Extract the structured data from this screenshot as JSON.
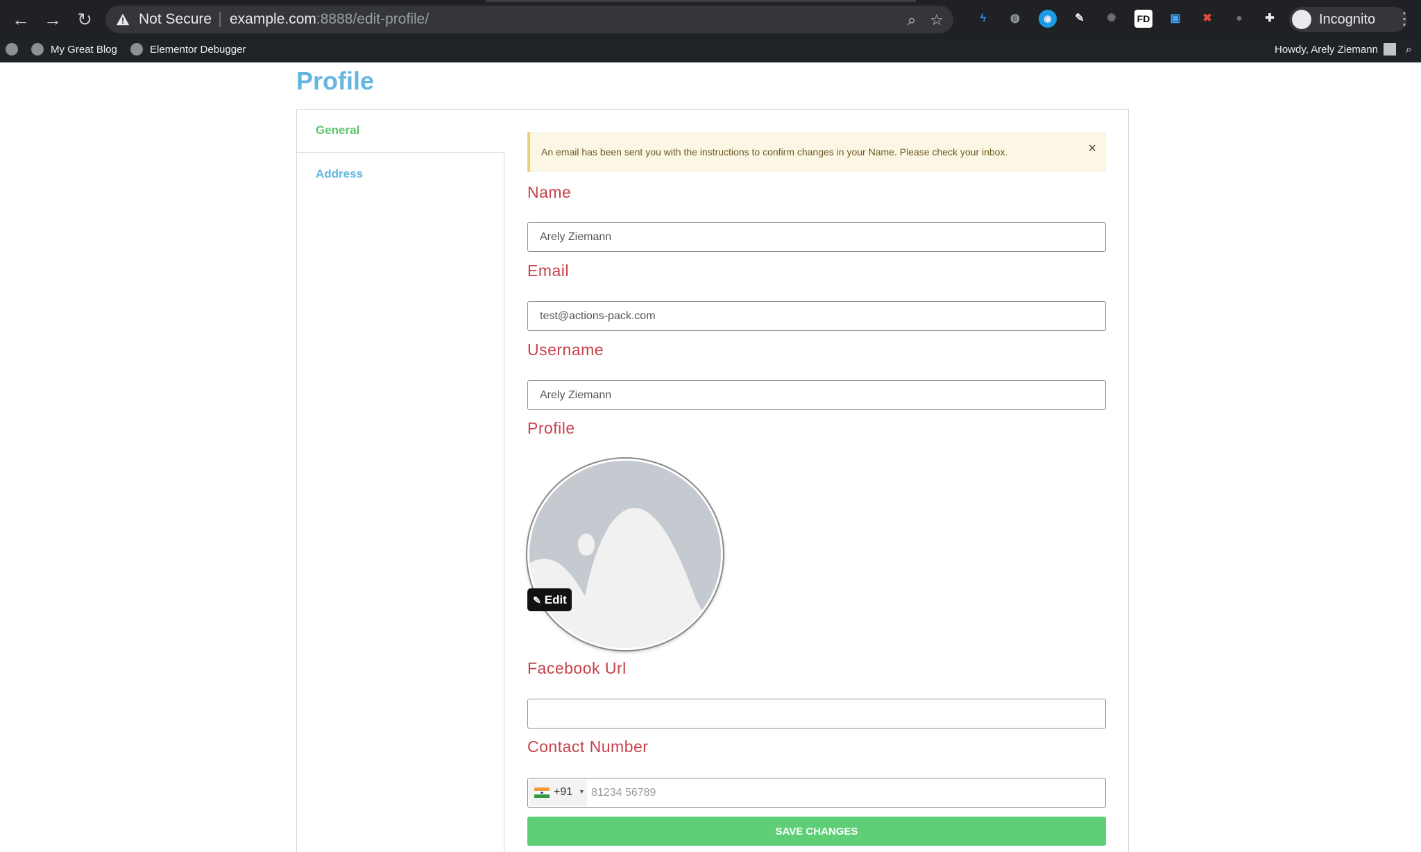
{
  "browser": {
    "security_label": "Not Secure",
    "url_host": "example.com",
    "url_path": ":8888/edit-profile/",
    "incognito_label": "Incognito"
  },
  "adminbar": {
    "site_name": "My Great Blog",
    "debugger": "Elementor Debugger",
    "greeting": "Howdy, Arely Ziemann"
  },
  "page": {
    "title": "Profile"
  },
  "tabs": {
    "general": "General",
    "address": "Address"
  },
  "notice": {
    "text": "An email has been sent you with the instructions to confirm changes in your Name. Please check your inbox.",
    "close": "×"
  },
  "form": {
    "name_label": "Name",
    "name_value": "Arely Ziemann",
    "email_label": "Email",
    "email_value": "test@actions-pack.com",
    "username_label": "Username",
    "username_value": "Arely Ziemann",
    "profile_label": "Profile",
    "edit_label": "Edit",
    "facebook_label": "Facebook Url",
    "facebook_value": "",
    "contact_label": "Contact Number",
    "dial_code": "+91",
    "phone_placeholder": "81234 56789",
    "save_label": "SAVE CHANGES"
  },
  "colors": {
    "accent_blue": "#62b6e0",
    "accent_green": "#5ec36e",
    "label_red": "#c7414a",
    "save_green": "#5fcf77"
  }
}
